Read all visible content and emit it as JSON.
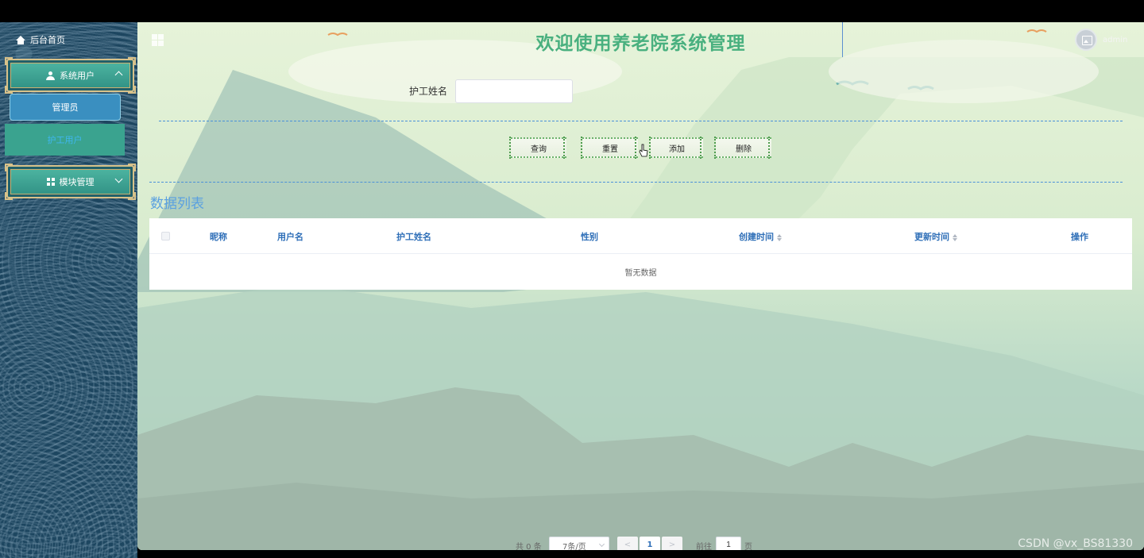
{
  "sidebar": {
    "home_label": "后台首页",
    "menus": [
      {
        "label": "系统用户",
        "children": [
          {
            "label": "管理员"
          },
          {
            "label": "护工用户"
          }
        ]
      },
      {
        "label": "模块管理"
      }
    ]
  },
  "header": {
    "title": "欢迎使用养老院系统管理",
    "username": "admin"
  },
  "search": {
    "label": "护工姓名",
    "value": "",
    "placeholder": ""
  },
  "actions": {
    "query": "查询",
    "reset": "重置",
    "add": "添加",
    "delete": "删除"
  },
  "list": {
    "title": "数据列表",
    "columns": [
      "昵称",
      "用户名",
      "护工姓名",
      "性别",
      "创建时间",
      "更新时间",
      "操作"
    ],
    "empty_text": "暂无数据"
  },
  "pagination": {
    "total_text": "共 0 条",
    "page_size": "7条/页",
    "prev": "<",
    "current_page": "1",
    "next": ">",
    "goto_label": "前往",
    "goto_value": "1",
    "page_unit": "页"
  },
  "watermark": "CSDN @vx_BS81330",
  "colors": {
    "title": "#49b07f",
    "sidebar_bg": "#1d4660",
    "accent_blue": "#2f6fb8",
    "menu_teal": "#3aa38f"
  }
}
